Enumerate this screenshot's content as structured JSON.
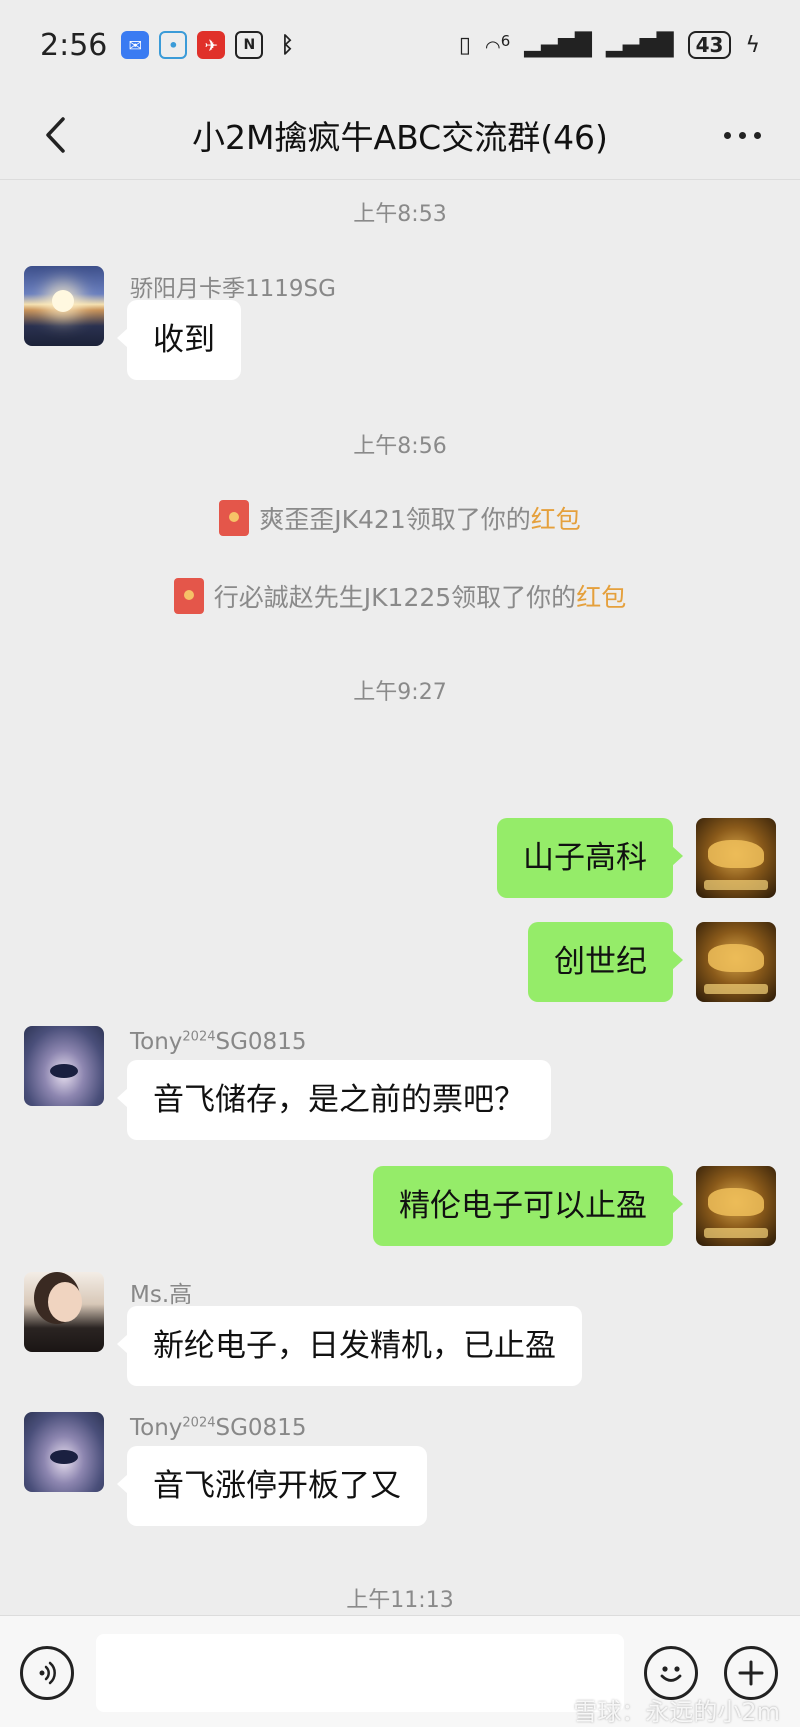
{
  "status_bar": {
    "time": "2:56",
    "network": "6",
    "battery": "43"
  },
  "header": {
    "title": "小2M擒疯牛ABC交流群(46)"
  },
  "messages": {
    "ts1": "上午8:53",
    "m1": {
      "sender": "骄阳月卡季1119SG",
      "text": "收到"
    },
    "ts2": "上午8:56",
    "sys1": {
      "prefix": "爽歪歪JK421领取了你的",
      "link": "红包"
    },
    "sys2": {
      "prefix": "行必誠赵先生JK1225领取了你的",
      "link": "红包"
    },
    "ts3": "上午9:27",
    "m2": {
      "text": "山子高科"
    },
    "m3": {
      "text": "创世纪"
    },
    "m4": {
      "sender_main": "Tony",
      "sender_sup": "2024",
      "sender_tail": "SG0815",
      "text": "音飞储存，是之前的票吧？"
    },
    "m5": {
      "text": "精伦电子可以止盈"
    },
    "m6": {
      "sender": "Ms.高",
      "text": "新纶电子，日发精机，已止盈"
    },
    "m7": {
      "sender_main": "Tony",
      "sender_sup": "2024",
      "sender_tail": "SG0815",
      "text": "音飞涨停开板了又"
    },
    "ts4": "上午11:13"
  },
  "watermark": "雪球：永远的小2m",
  "icons": {
    "back": "chevron-left-icon",
    "more": "more-dots-icon",
    "voice": "voice-icon",
    "emoji": "emoji-icon",
    "plus": "plus-icon",
    "red_packet": "red-packet-icon"
  },
  "colors": {
    "outgoing_bubble": "#95ec69",
    "incoming_bubble": "#ffffff",
    "red_packet_link": "#e5a03c",
    "background": "#ededed"
  }
}
